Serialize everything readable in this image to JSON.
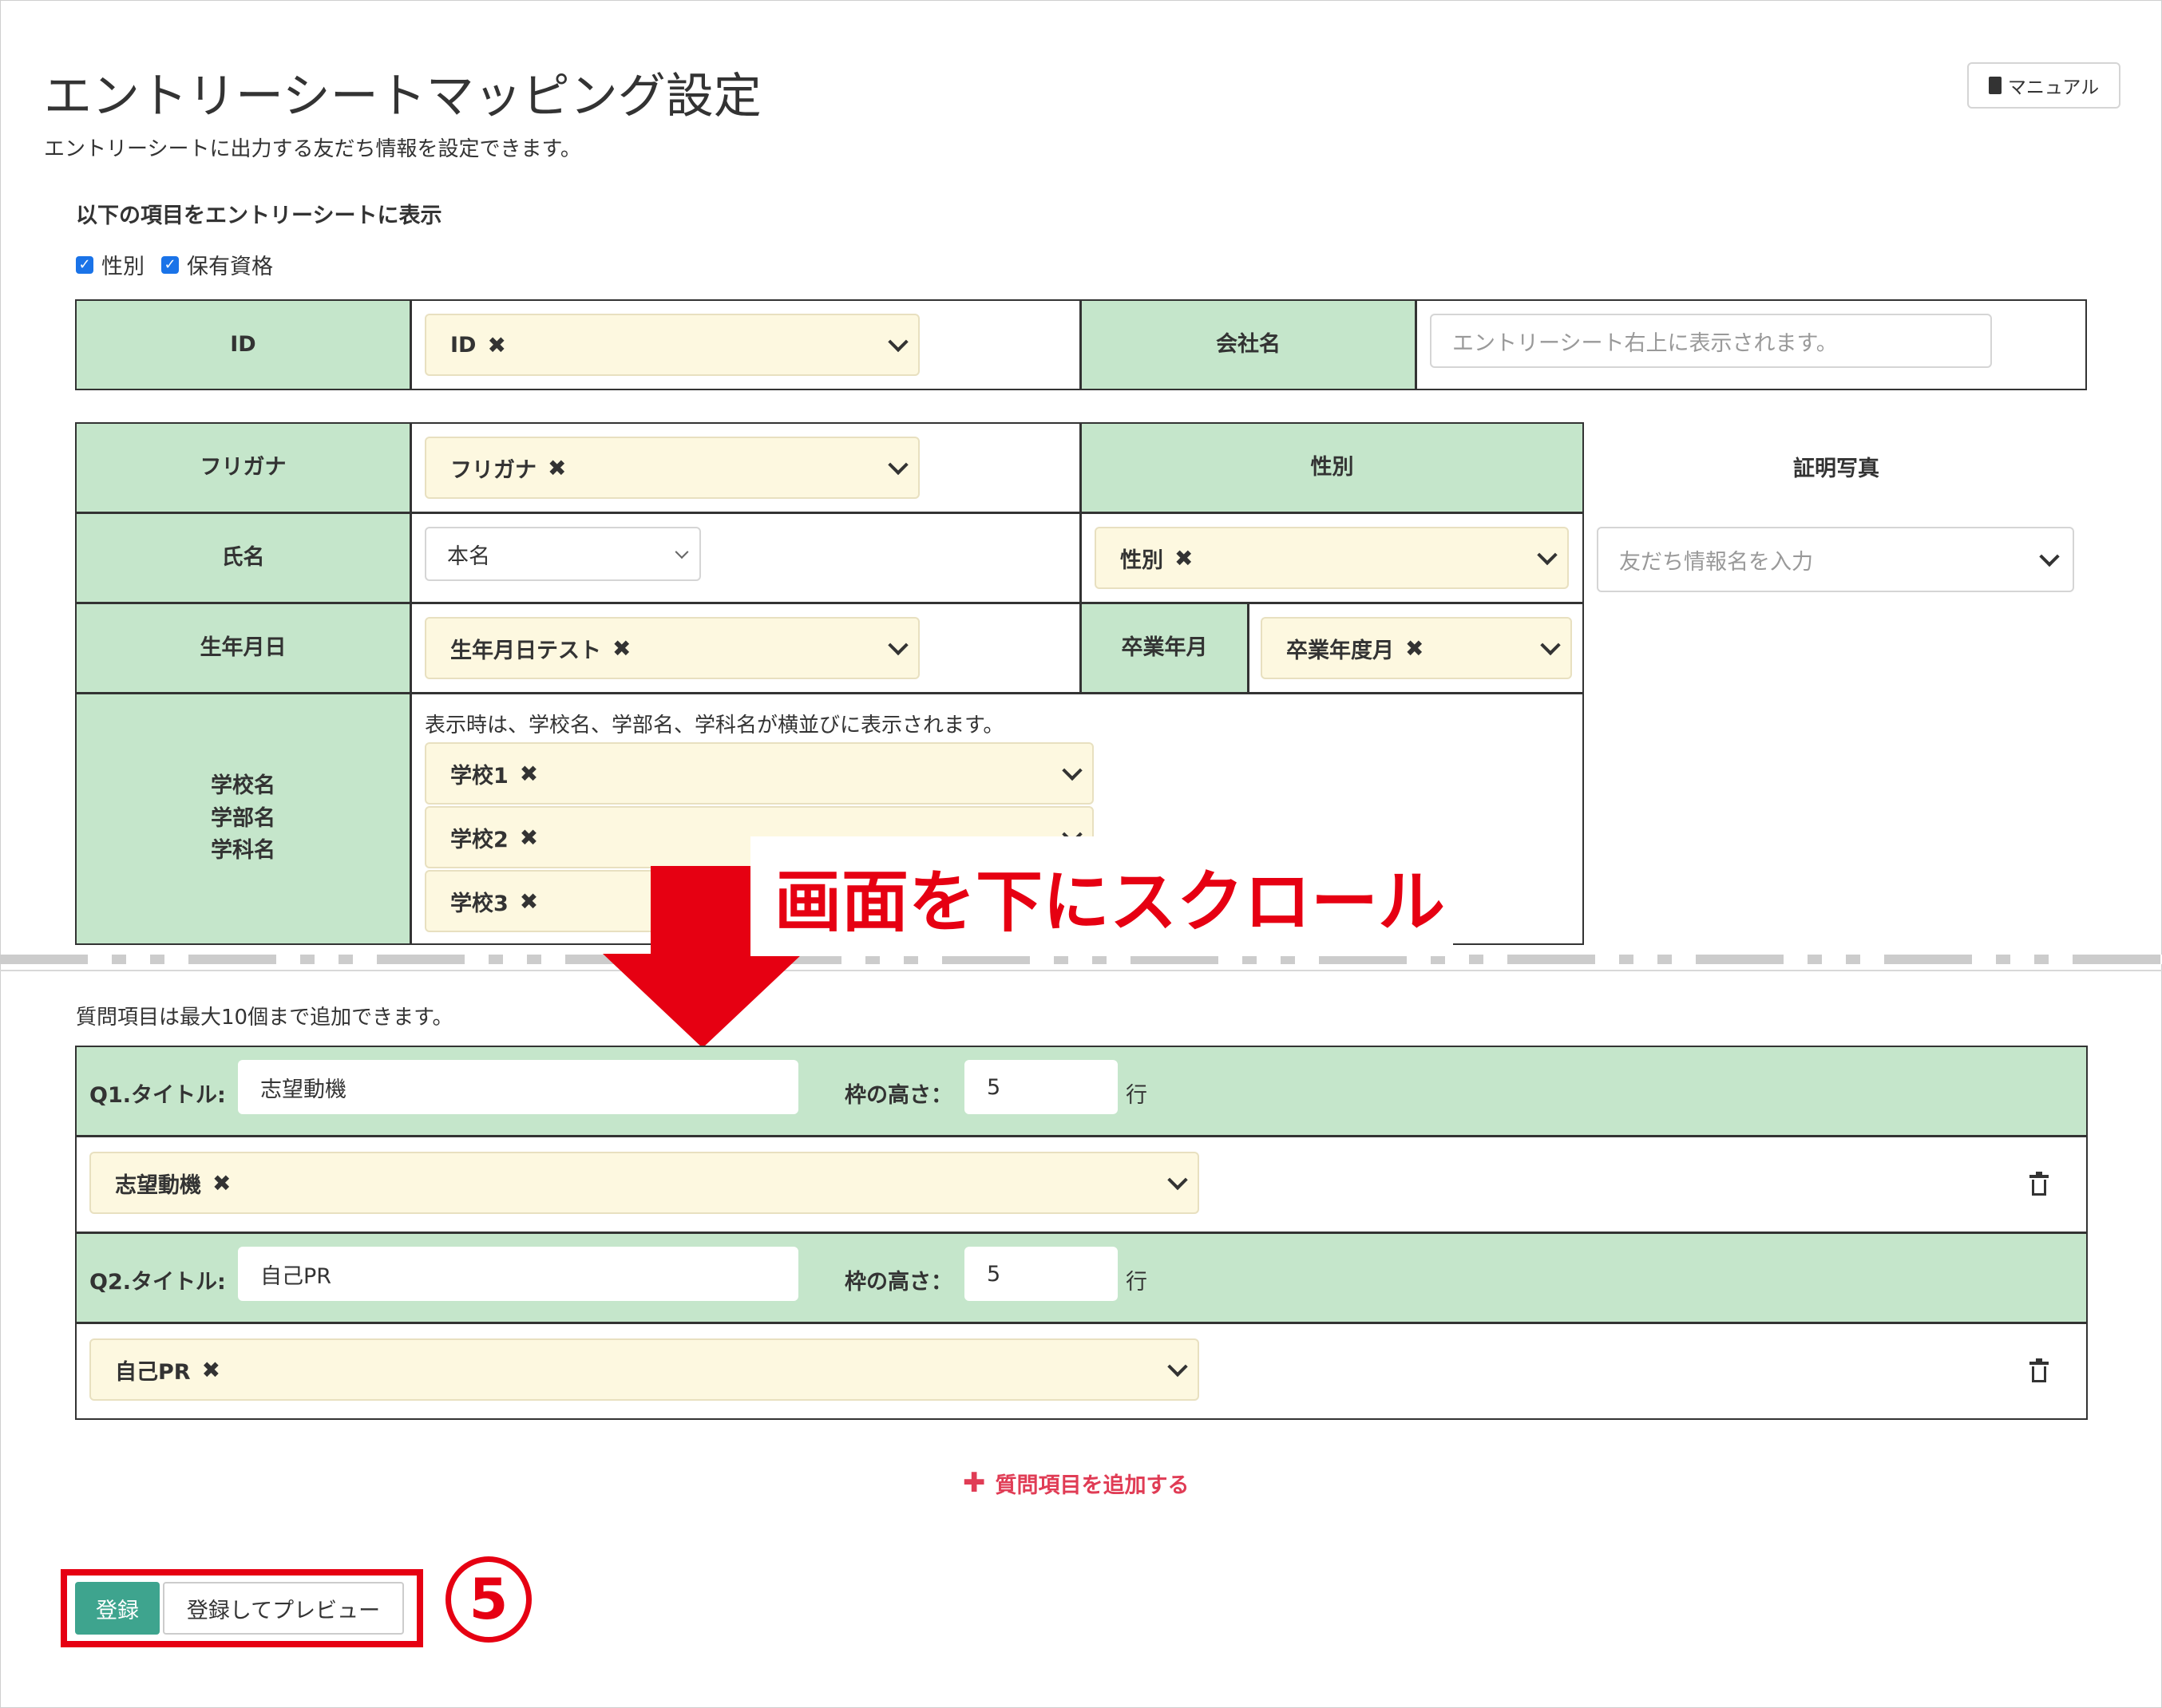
{
  "header": {
    "title": "エントリーシートマッピング設定",
    "subtitle": "エントリーシートに出力する友だち情報を設定できます。",
    "manual_label": "マニュアル"
  },
  "display_section": {
    "label": "以下の項目をエントリーシートに表示",
    "checkboxes": [
      {
        "label": "性別",
        "checked": true
      },
      {
        "label": "保有資格",
        "checked": true
      }
    ]
  },
  "top_table": {
    "id_label": "ID",
    "id_tag": "ID",
    "company_label": "会社名",
    "company_placeholder": "エントリーシート右上に表示されます。"
  },
  "main_table": {
    "furigana_label": "フリガナ",
    "furigana_tag": "フリガナ",
    "name_label": "氏名",
    "name_select": "本名",
    "birth_label": "生年月日",
    "birth_tag": "生年月日テスト",
    "school_label": "学校名\n学部名\n学科名",
    "school_note": "表示時は、学校名、学部名、学科名が横並びに表示されます。",
    "school_tags": [
      "学校1",
      "学校2",
      "学校3"
    ],
    "gender_label": "性別",
    "gender_tag": "性別",
    "grad_label": "卒業年月",
    "grad_tag": "卒業年度月",
    "photo_label": "証明写真",
    "photo_placeholder": "友だち情報名を入力"
  },
  "annotation": {
    "scroll_text": "画面を下にスクロール",
    "step_number": "5",
    "arrow_color": "#e60012"
  },
  "questions": {
    "note": "質問項目は最大10個まで追加できます。",
    "height_label": "枠の高さ：",
    "rows_unit": "行",
    "items": [
      {
        "label": "Q1.タイトル:",
        "title": "志望動機",
        "height": "5",
        "tag": "志望動機"
      },
      {
        "label": "Q2.タイトル:",
        "title": "自己PR",
        "height": "5",
        "tag": "自己PR"
      }
    ],
    "add_label": "質問項目を追加する"
  },
  "footer": {
    "save_label": "登録",
    "preview_label": "登録してプレビュー"
  },
  "colors": {
    "label_bg": "#c5e6cb",
    "tag_bg": "#fdf8e0",
    "save_bg": "#3ea48e",
    "accent_red": "#e60012",
    "add_link": "#e03c55"
  }
}
